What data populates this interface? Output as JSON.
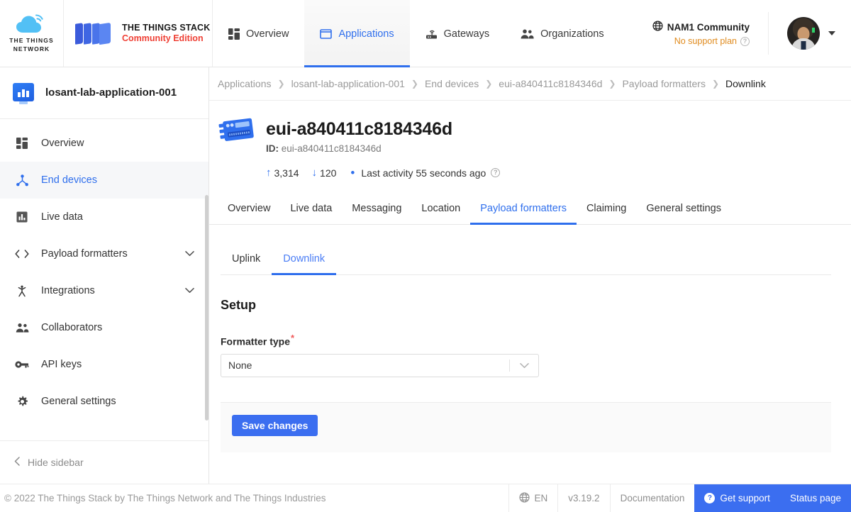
{
  "brand": {
    "ttn_line1": "THE THINGS",
    "ttn_line2": "NETWORK",
    "stack_line1": "THE THINGS STACK",
    "stack_line2": "Community Edition",
    "accent_blue": "#2f6fed",
    "accent_red": "#ef4136",
    "warn_orange": "#e08b1e"
  },
  "topnav": {
    "items": [
      {
        "label": "Overview",
        "icon": "grid-icon",
        "active": false
      },
      {
        "label": "Applications",
        "icon": "application-square-icon",
        "active": true
      },
      {
        "label": "Gateways",
        "icon": "gateway-router-icon",
        "active": false
      },
      {
        "label": "Organizations",
        "icon": "people-icon",
        "active": false
      }
    ],
    "cluster": "NAM1 Community",
    "support_plan": "No support plan"
  },
  "sidebar": {
    "app_name": "losant-lab-application-001",
    "items": [
      {
        "label": "Overview",
        "icon": "grid-icon",
        "active": false,
        "expandable": false
      },
      {
        "label": "End devices",
        "icon": "end-device-node-icon",
        "active": true,
        "expandable": false
      },
      {
        "label": "Live data",
        "icon": "live-data-chart-icon",
        "active": false,
        "expandable": false
      },
      {
        "label": "Payload formatters",
        "icon": "code-brackets-icon",
        "active": false,
        "expandable": true
      },
      {
        "label": "Integrations",
        "icon": "integrations-icon",
        "active": false,
        "expandable": true
      },
      {
        "label": "Collaborators",
        "icon": "people-icon",
        "active": false,
        "expandable": false
      },
      {
        "label": "API keys",
        "icon": "key-icon",
        "active": false,
        "expandable": false
      },
      {
        "label": "General settings",
        "icon": "gear-icon",
        "active": false,
        "expandable": false
      }
    ],
    "hide_label": "Hide sidebar"
  },
  "breadcrumb": [
    {
      "label": "Applications",
      "last": false
    },
    {
      "label": "losant-lab-application-001",
      "last": false
    },
    {
      "label": "End devices",
      "last": false
    },
    {
      "label": "eui-a840411c8184346d",
      "last": false
    },
    {
      "label": "Payload formatters",
      "last": false
    },
    {
      "label": "Downlink",
      "last": true
    }
  ],
  "device": {
    "title": "eui-a840411c8184346d",
    "id_prefix": "ID:",
    "id_value": "eui-a840411c8184346d",
    "uplink_arrow": "↑",
    "uplink_count": "3,314",
    "downlink_arrow": "↓",
    "downlink_count": "120",
    "activity": "Last activity 55 seconds ago",
    "help_glyph": "?"
  },
  "tabs": [
    {
      "label": "Overview",
      "active": false
    },
    {
      "label": "Live data",
      "active": false
    },
    {
      "label": "Messaging",
      "active": false
    },
    {
      "label": "Location",
      "active": false
    },
    {
      "label": "Payload formatters",
      "active": true
    },
    {
      "label": "Claiming",
      "active": false
    },
    {
      "label": "General settings",
      "active": false
    }
  ],
  "subtabs": [
    {
      "label": "Uplink",
      "active": false
    },
    {
      "label": "Downlink",
      "active": true
    }
  ],
  "setup": {
    "heading": "Setup",
    "formatter_label": "Formatter type",
    "required_mark": "*",
    "formatter_value": "None",
    "save_label": "Save changes"
  },
  "footer": {
    "copyright": "© 2022 The Things Stack by The Things Network and The Things Industries",
    "language": "EN",
    "version": "v3.19.2",
    "documentation": "Documentation",
    "get_support": "Get support",
    "status_page": "Status page",
    "support_glyph": "?"
  }
}
